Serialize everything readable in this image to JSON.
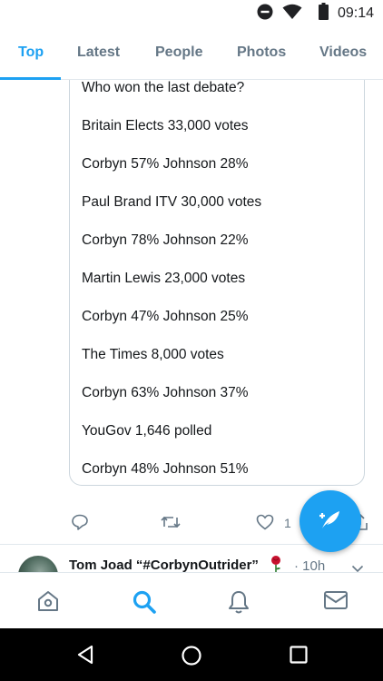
{
  "status_bar": {
    "time": "09:14",
    "icons": [
      "do-not-disturb-icon",
      "wifi-icon",
      "battery-icon"
    ]
  },
  "tabs": [
    {
      "label": "Top",
      "active": true
    },
    {
      "label": "Latest",
      "active": false
    },
    {
      "label": "People",
      "active": false
    },
    {
      "label": "Photos",
      "active": false
    },
    {
      "label": "Videos",
      "active": false
    }
  ],
  "quoted_text": {
    "lines": [
      "Who won the last debate?",
      "Britain Elects 33,000 votes",
      "Corbyn 57% Johnson 28%",
      "Paul Brand ITV 30,000 votes",
      "Corbyn 78% Johnson 22%",
      "Martin Lewis 23,000 votes",
      "Corbyn 47% Johnson 25%",
      "The Times 8,000 votes",
      "Corbyn 63% Johnson 37%",
      "YouGov 1,646 polled",
      "Corbyn 48% Johnson 51%"
    ]
  },
  "actions": {
    "icons": [
      "reply-icon",
      "retweet-icon",
      "like-icon",
      "share-icon"
    ],
    "like_count": "1"
  },
  "next_tweet": {
    "author": "Tom Joad “#CorbynOutrider”",
    "emoji": "rose-icon",
    "time": "· 10h"
  },
  "fab": {
    "icon": "compose-tweet-icon"
  },
  "bottom_nav": {
    "items": [
      "home-icon",
      "search-icon",
      "notifications-icon",
      "messages-icon"
    ],
    "active": "search-icon"
  },
  "system_nav": {
    "items": [
      "back-icon",
      "home-circle-icon",
      "recents-icon"
    ]
  },
  "colors": {
    "accent": "#1da1f2",
    "secondary_text": "#657786",
    "primary_text": "#14171a",
    "border": "#e1e8ed"
  }
}
